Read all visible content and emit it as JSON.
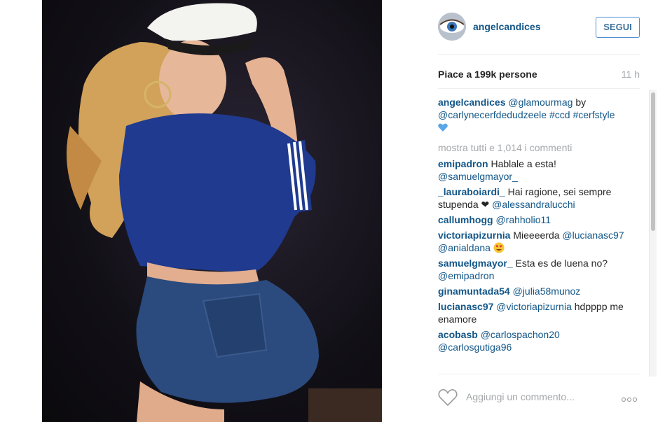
{
  "post": {
    "username": "angelcandices",
    "follow_label": "SEGUI",
    "likes": "Piace a 199k persone",
    "time": "11 h",
    "caption": {
      "user": "angelcandices",
      "mention1": "@glamourmag",
      "text1": "by",
      "mention2": "@carlynecerfdedudzeele",
      "tag1": "#ccd",
      "tag2": "#cerfstyle",
      "emoji": "blue-heart"
    },
    "more_comments": "mostra tutti e 1,014 i commenti",
    "comments": [
      {
        "user": "emipadron",
        "text": "Hablale a esta!",
        "mention": "@samuelgmayor_"
      },
      {
        "user": "_lauraboiardi_",
        "text": "Hai ragione, sei sempre stupenda",
        "mention": "@alessandralucchi"
      },
      {
        "user": "callumhogg",
        "text": "",
        "mention": "@rahholio11"
      },
      {
        "user": "victoriapizurnia",
        "text": "Mieeeerda",
        "mention": "@lucianasc97",
        "mention2": "@anialdana"
      },
      {
        "user": "samuelgmayor_",
        "text": "Esta es de luena no?",
        "mention": "@emipadron"
      },
      {
        "user": "ginamuntada54",
        "text": "",
        "mention": "@julia58munoz"
      },
      {
        "user": "lucianasc97",
        "text": "hdpppp me enamore",
        "mention": "@victoriapizurnia"
      },
      {
        "user": "acobasb",
        "text": "",
        "mention": "@carlospachon20",
        "mention2": "@carlosgutiga96"
      }
    ],
    "add_comment_placeholder": "Aggiungi un commento...",
    "icons": {
      "like": "heart-outline-icon",
      "more": "more-options-icon",
      "heart_emoji": "black-heart",
      "smile_emoji": "heart-eyes-emoji"
    },
    "colors": {
      "link": "#125688",
      "follow_border": "#4e8fd0",
      "muted": "#a5a7aa"
    }
  }
}
